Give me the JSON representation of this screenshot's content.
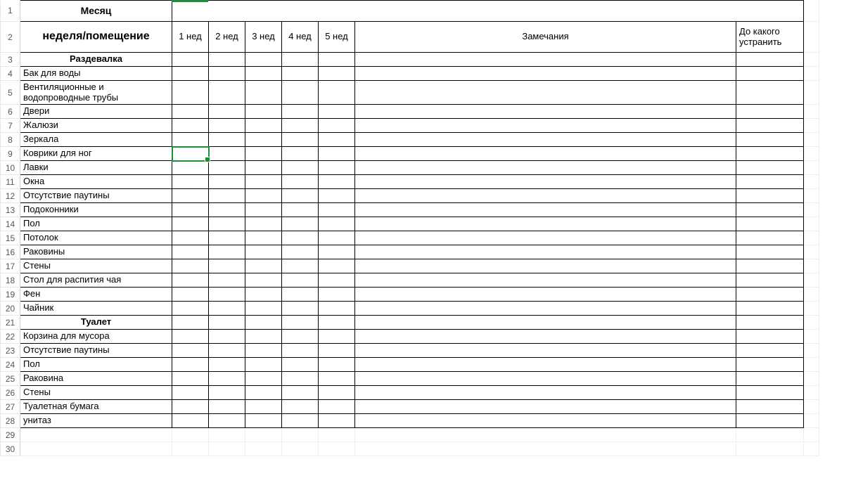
{
  "headers": {
    "month": "Месяц",
    "week_room": "неделя/помещение",
    "weeks": [
      "1 нед",
      "2 нед",
      "3 нед",
      "4 нед",
      "5 нед"
    ],
    "notes": "Замечания",
    "deadline": "До какого устранить"
  },
  "rows": [
    {
      "n": 1,
      "type": "month"
    },
    {
      "n": 2,
      "type": "header2"
    },
    {
      "n": 3,
      "type": "section",
      "label": "Раздевалка"
    },
    {
      "n": 4,
      "type": "item",
      "label": "Бак для воды"
    },
    {
      "n": 5,
      "type": "item",
      "label": "Вентиляционные и водопроводные трубы",
      "tall": true
    },
    {
      "n": 6,
      "type": "item",
      "label": "Двери"
    },
    {
      "n": 7,
      "type": "item",
      "label": "Жалюзи"
    },
    {
      "n": 8,
      "type": "item",
      "label": "Зеркала"
    },
    {
      "n": 9,
      "type": "item",
      "label": "Коврики для ног"
    },
    {
      "n": 10,
      "type": "item",
      "label": "Лавки"
    },
    {
      "n": 11,
      "type": "item",
      "label": "Окна"
    },
    {
      "n": 12,
      "type": "item",
      "label": "Отсутствие паутины"
    },
    {
      "n": 13,
      "type": "item",
      "label": "Подоконники"
    },
    {
      "n": 14,
      "type": "item",
      "label": "Пол"
    },
    {
      "n": 15,
      "type": "item",
      "label": "Потолок"
    },
    {
      "n": 16,
      "type": "item",
      "label": "Раковины"
    },
    {
      "n": 17,
      "type": "item",
      "label": "Стены"
    },
    {
      "n": 18,
      "type": "item",
      "label": "Стол для распития чая"
    },
    {
      "n": 19,
      "type": "item",
      "label": "Фен"
    },
    {
      "n": 20,
      "type": "item",
      "label": "Чайник"
    },
    {
      "n": 21,
      "type": "section",
      "label": "Туалет"
    },
    {
      "n": 22,
      "type": "item",
      "label": "Корзина для мусора"
    },
    {
      "n": 23,
      "type": "item",
      "label": "Отсутствие паутины"
    },
    {
      "n": 24,
      "type": "item",
      "label": "Пол"
    },
    {
      "n": 25,
      "type": "item",
      "label": "Раковина"
    },
    {
      "n": 26,
      "type": "item",
      "label": "Стены"
    },
    {
      "n": 27,
      "type": "item",
      "label": "Туалетная бумага"
    },
    {
      "n": 28,
      "type": "item",
      "label": "унитаз"
    },
    {
      "n": 29,
      "type": "empty"
    },
    {
      "n": 30,
      "type": "empty"
    }
  ],
  "active_cell": {
    "row": 9,
    "col": "B"
  }
}
